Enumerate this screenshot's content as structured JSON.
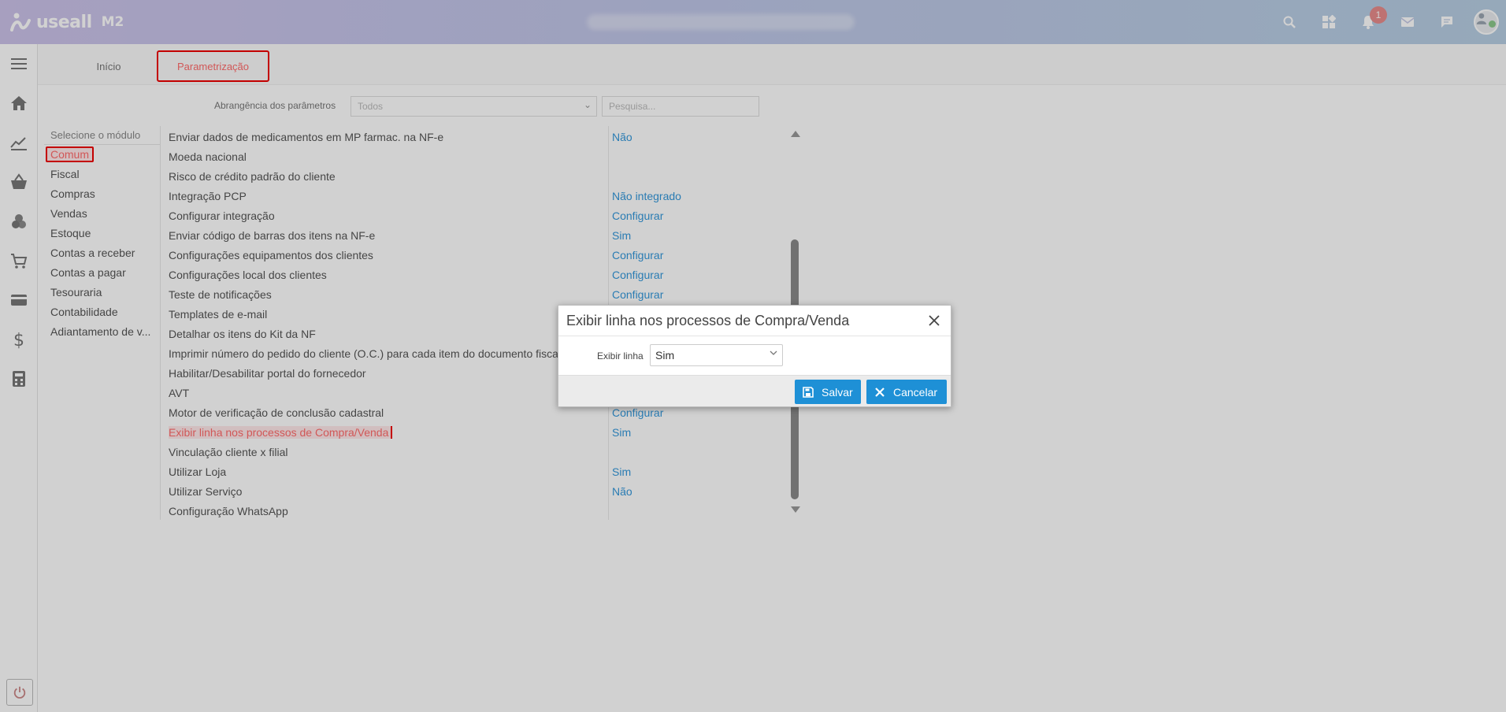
{
  "app": {
    "logo_text": "useall",
    "logo_suffix": "M2",
    "notification_count": "1"
  },
  "tabs": [
    {
      "label": "Início"
    },
    {
      "label": "Parametrização"
    }
  ],
  "filters": {
    "scope_label": "Abrangência dos parâmetros",
    "scope_placeholder": "Todos",
    "search_placeholder": "Pesquisa..."
  },
  "modules": {
    "header": "Selecione o módulo",
    "items": [
      "Comum",
      "Fiscal",
      "Compras",
      "Vendas",
      "Estoque",
      "Contas a receber",
      "Contas a pagar",
      "Tesouraria",
      "Contabilidade",
      "Adiantamento de v..."
    ]
  },
  "params": [
    {
      "name": "Enviar dados de medicamentos em MP farmac. na NF-e",
      "value": "Não"
    },
    {
      "name": "Moeda nacional",
      "value": ""
    },
    {
      "name": "Risco de crédito padrão do cliente",
      "value": ""
    },
    {
      "name": "Integração PCP",
      "value": "Não integrado"
    },
    {
      "name": "Configurar integração",
      "value": "Configurar"
    },
    {
      "name": "Enviar código de barras dos itens na NF-e",
      "value": "Sim"
    },
    {
      "name": "Configurações equipamentos dos clientes",
      "value": "Configurar"
    },
    {
      "name": "Configurações local dos clientes",
      "value": "Configurar"
    },
    {
      "name": "Teste de notificações",
      "value": "Configurar"
    },
    {
      "name": "Templates de e-mail",
      "value": ""
    },
    {
      "name": "Detalhar os itens do Kit da NF",
      "value": ""
    },
    {
      "name": "Imprimir número do pedido do cliente (O.C.) para cada item do documento fiscal",
      "value": ""
    },
    {
      "name": "Habilitar/Desabilitar portal do fornecedor",
      "value": ""
    },
    {
      "name": "AVT",
      "value": ""
    },
    {
      "name": "Motor de verificação de conclusão cadastral",
      "value": "Configurar"
    },
    {
      "name": "Exibir linha nos processos de Compra/Venda",
      "value": "Sim"
    },
    {
      "name": "Vinculação cliente x filial",
      "value": ""
    },
    {
      "name": "Utilizar Loja",
      "value": "Sim"
    },
    {
      "name": "Utilizar Serviço",
      "value": "Não"
    },
    {
      "name": "Configuração WhatsApp",
      "value": ""
    }
  ],
  "modal": {
    "title": "Exibir linha nos processos de Compra/Venda",
    "field_label": "Exibir linha",
    "field_value": "Sim",
    "save_label": "Salvar",
    "cancel_label": "Cancelar"
  }
}
